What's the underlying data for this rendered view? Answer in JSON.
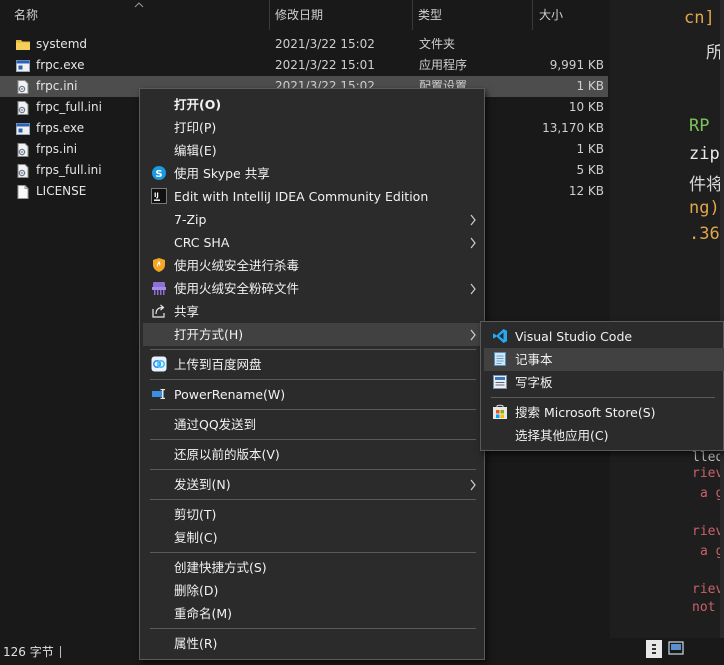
{
  "columns": {
    "name": "名称",
    "date": "修改日期",
    "type": "类型",
    "size": "大小"
  },
  "files": [
    {
      "name": "systemd",
      "date": "2021/3/22 15:02",
      "type": "文件夹",
      "size": "",
      "icon": "folder-icon"
    },
    {
      "name": "frpc.exe",
      "date": "2021/3/22 15:01",
      "type": "应用程序",
      "size": "9,991 KB",
      "icon": "exe-icon"
    },
    {
      "name": "frpc.ini",
      "date": "2021/3/22 15:02",
      "type": "配置设置",
      "size": "1 KB",
      "icon": "ini-icon"
    },
    {
      "name": "frpc_full.ini",
      "date": "",
      "type": "",
      "size": "10 KB",
      "icon": "ini-icon"
    },
    {
      "name": "frps.exe",
      "date": "",
      "type": "",
      "size": "13,170 KB",
      "icon": "exe-icon"
    },
    {
      "name": "frps.ini",
      "date": "",
      "type": "",
      "size": "1 KB",
      "icon": "ini-icon"
    },
    {
      "name": "frps_full.ini",
      "date": "",
      "type": "",
      "size": "5 KB",
      "icon": "ini-icon"
    },
    {
      "name": "LICENSE",
      "date": "",
      "type": "",
      "size": "12 KB",
      "icon": "file-icon"
    }
  ],
  "status": {
    "text": "126 字节"
  },
  "context_menu": {
    "items": [
      {
        "label": "打开(O)",
        "icon": ""
      },
      {
        "label": "打印(P)",
        "icon": ""
      },
      {
        "label": "编辑(E)",
        "icon": ""
      },
      {
        "label": "使用 Skype 共享",
        "icon": "skype-icon"
      },
      {
        "label": "Edit with IntelliJ IDEA Community Edition",
        "icon": "intellij-icon"
      },
      {
        "label": "7-Zip",
        "icon": ""
      },
      {
        "label": "CRC SHA",
        "icon": ""
      },
      {
        "label": "使用火绒安全进行杀毒",
        "icon": "huorong-shield-icon"
      },
      {
        "label": "使用火绒安全粉碎文件",
        "icon": "shredder-icon"
      },
      {
        "label": "共享",
        "icon": "share-icon"
      },
      {
        "label": "打开方式(H)",
        "icon": ""
      },
      {
        "label": "上传到百度网盘",
        "icon": "baidu-netdisk-icon"
      },
      {
        "label": "PowerRename(W)",
        "icon": "powerrename-icon"
      },
      {
        "label": "通过QQ发送到",
        "icon": ""
      },
      {
        "label": "还原以前的版本(V)",
        "icon": ""
      },
      {
        "label": "发送到(N)",
        "icon": ""
      },
      {
        "label": "剪切(T)",
        "icon": ""
      },
      {
        "label": "复制(C)",
        "icon": ""
      },
      {
        "label": "创建快捷方式(S)",
        "icon": ""
      },
      {
        "label": "删除(D)",
        "icon": ""
      },
      {
        "label": "重命名(M)",
        "icon": ""
      },
      {
        "label": "属性(R)",
        "icon": ""
      }
    ]
  },
  "open_with_menu": {
    "items": [
      {
        "label": "Visual Studio Code",
        "icon": "vscode-icon"
      },
      {
        "label": "记事本",
        "icon": "notepad-icon"
      },
      {
        "label": "写字板",
        "icon": "wordpad-icon"
      },
      {
        "label": "搜索 Microsoft Store(S)",
        "icon": "store-icon"
      },
      {
        "label": "选择其他应用(C)",
        "icon": ""
      }
    ]
  },
  "editor": {
    "lines": [
      "cn]",
      "所",
      "RP",
      "zip",
      "件将",
      "ng)",
      ".36",
      "lled",
      "rieve",
      "a ga",
      "rieve",
      "a ga",
      "rieve",
      "not a"
    ]
  },
  "colors": {
    "menu_bg": "#2b2b2b",
    "selected_row": "#4d4d4d",
    "menu_hover": "#414141",
    "vscode_blue": "#23a9f2",
    "editor_green": "#7cc35d",
    "editor_yellow": "#e0a64a",
    "editor_red": "#c8616b"
  }
}
